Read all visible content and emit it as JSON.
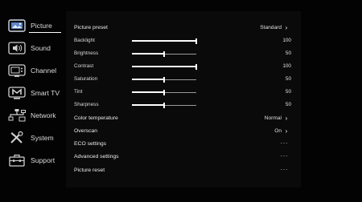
{
  "sidebar": {
    "items": [
      {
        "label": "Picture",
        "icon": "picture-icon",
        "active": true
      },
      {
        "label": "Sound",
        "icon": "speaker-icon",
        "active": false
      },
      {
        "label": "Channel",
        "icon": "tv-icon",
        "active": false
      },
      {
        "label": "Smart TV",
        "icon": "smart-tv-icon",
        "active": false
      },
      {
        "label": "Network",
        "icon": "network-icon",
        "active": false
      },
      {
        "label": "System",
        "icon": "tools-icon",
        "active": false
      },
      {
        "label": "Support",
        "icon": "toolbox-icon",
        "active": false
      }
    ]
  },
  "menu": {
    "picture_preset": {
      "label": "Picture preset",
      "value": "Standard"
    },
    "backlight": {
      "label": "Backlight",
      "value": "100",
      "level": 1.0
    },
    "brightness": {
      "label": "Brightness",
      "value": "50",
      "level": 0.5
    },
    "contrast": {
      "label": "Contrast",
      "value": "100",
      "level": 1.0
    },
    "saturation": {
      "label": "Saturation",
      "value": "50",
      "level": 0.5
    },
    "tint": {
      "label": "Tint",
      "value": "50",
      "level": 0.5
    },
    "sharpness": {
      "label": "Sharpness",
      "value": "50",
      "level": 0.5
    },
    "color_temperature": {
      "label": "Color temperature",
      "value": "Normal"
    },
    "overscan": {
      "label": "Overscan",
      "value": "On"
    },
    "eco_settings": {
      "label": "ECO settings",
      "value": "···"
    },
    "advanced_settings": {
      "label": "Advanced settings",
      "value": "···"
    },
    "picture_reset": {
      "label": "Picture reset",
      "value": "···"
    },
    "chevron": "›"
  },
  "colors": {
    "background": "#030303",
    "panel": "#0a0a0a",
    "accent": "#ffffff"
  }
}
